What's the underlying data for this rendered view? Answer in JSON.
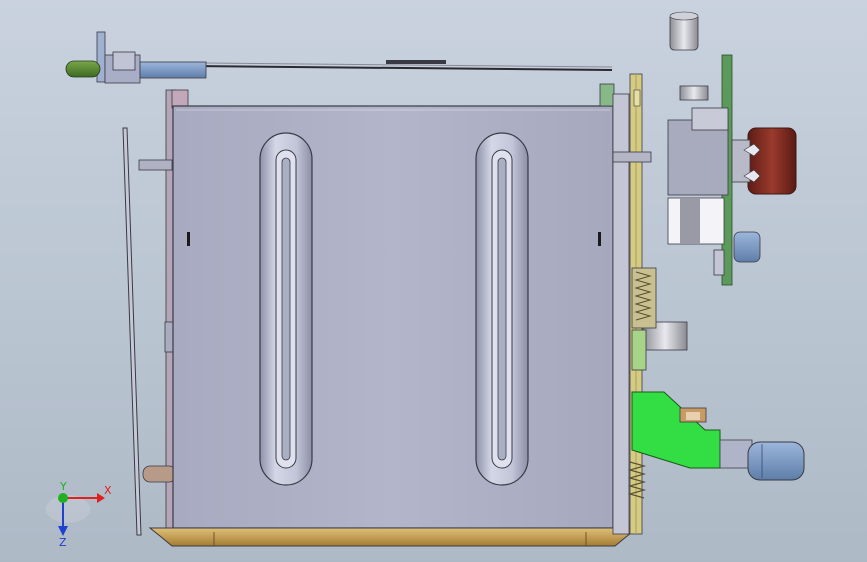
{
  "viewport": {
    "background_top": "#c9d2de",
    "background_bottom": "#aeb9c6"
  },
  "triad": {
    "x_label": "X",
    "y_label": "Y",
    "z_label": "Z",
    "x_color": "#e02020",
    "y_color": "#20b020",
    "z_color": "#2040d0"
  },
  "colors": {
    "housing": "#aeb0c6",
    "housing_edge": "#3a3a44",
    "slot": "#b8bccf",
    "tray": "#c8a25a",
    "pcb": "#5c9a5c",
    "bracket_green": "#33dd44",
    "knob": "#8a2e24",
    "pin_blue": "#7a9cc8",
    "rail_yellow": "#d8c878",
    "handle_tip": "#4a7a2a"
  }
}
